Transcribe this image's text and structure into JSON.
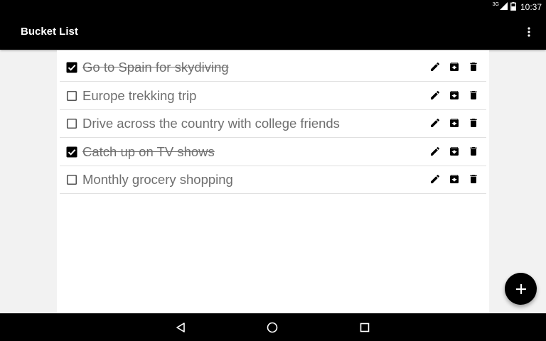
{
  "status_bar": {
    "network": "3G",
    "time": "10:37"
  },
  "app_bar": {
    "title": "Bucket List",
    "overflow_icon": "more-vert-icon"
  },
  "items": [
    {
      "text": "Go to Spain for skydiving",
      "checked": true
    },
    {
      "text": "Europe trekking trip",
      "checked": false
    },
    {
      "text": "Drive across the country with college friends",
      "checked": false
    },
    {
      "text": "Catch up on TV shows",
      "checked": true
    },
    {
      "text": "Monthly grocery shopping",
      "checked": false
    }
  ],
  "row_actions": [
    "edit-icon",
    "archive-icon",
    "delete-icon"
  ],
  "fab": {
    "icon": "add-icon"
  },
  "nav_bar": {
    "buttons": [
      "back-icon",
      "home-icon",
      "recents-icon"
    ]
  },
  "colors": {
    "bars": "#000000",
    "background": "#f2f2f2",
    "text": "#6f6f6f"
  }
}
